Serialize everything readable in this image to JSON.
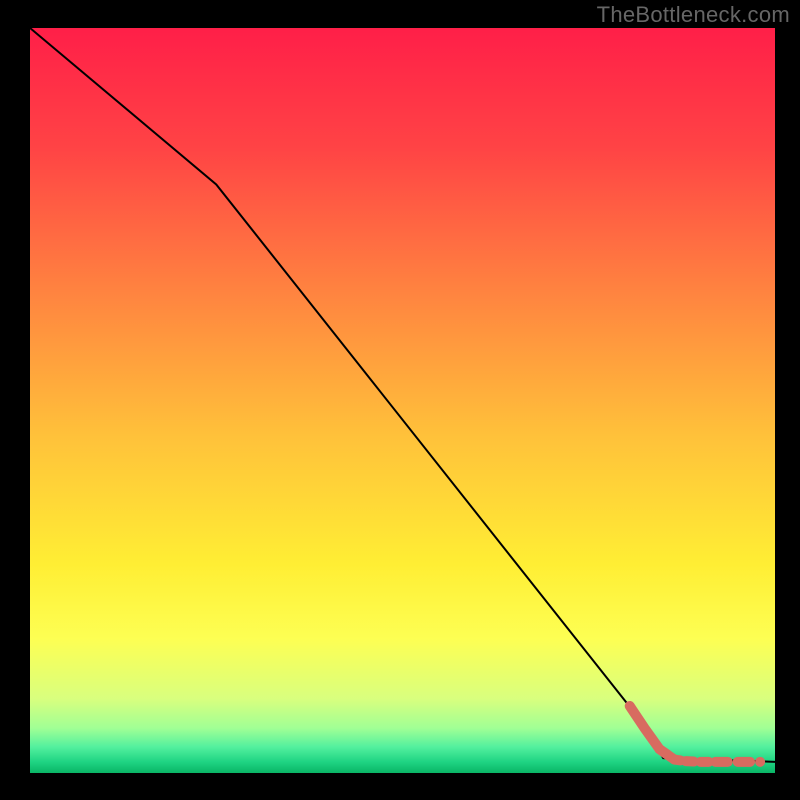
{
  "watermark": "TheBottleneck.com",
  "chart_data": {
    "type": "line",
    "title": "",
    "xlabel": "",
    "ylabel": "",
    "xlim": [
      0,
      100
    ],
    "ylim": [
      0,
      100
    ],
    "grid": false,
    "curve": {
      "name": "bottleneck-curve",
      "color": "#000000",
      "points": [
        {
          "x": 0,
          "y": 100
        },
        {
          "x": 25,
          "y": 79
        },
        {
          "x": 82,
          "y": 7
        },
        {
          "x": 85,
          "y": 2
        },
        {
          "x": 100,
          "y": 1.5
        }
      ]
    },
    "highlight": {
      "name": "bottleneck-highlight",
      "color": "#d86b60",
      "stroke_width": 10,
      "points": [
        {
          "x": 80.5,
          "y": 9
        },
        {
          "x": 82.5,
          "y": 6
        },
        {
          "x": 84.5,
          "y": 3.2
        },
        {
          "x": 86.5,
          "y": 1.8
        },
        {
          "x": 88,
          "y": 1.6
        },
        {
          "x": 90,
          "y": 1.5
        },
        {
          "x": 92,
          "y": 1.5
        },
        {
          "x": 95,
          "y": 1.5
        },
        {
          "x": 98,
          "y": 1.5
        }
      ]
    },
    "background_gradient": {
      "stops": [
        {
          "offset": 0.0,
          "color": "#ff1f48"
        },
        {
          "offset": 0.16,
          "color": "#ff4345"
        },
        {
          "offset": 0.35,
          "color": "#ff8240"
        },
        {
          "offset": 0.55,
          "color": "#ffc23a"
        },
        {
          "offset": 0.72,
          "color": "#ffee34"
        },
        {
          "offset": 0.82,
          "color": "#fdff53"
        },
        {
          "offset": 0.9,
          "color": "#d9ff7e"
        },
        {
          "offset": 0.94,
          "color": "#a0ff95"
        },
        {
          "offset": 0.965,
          "color": "#53f09e"
        },
        {
          "offset": 0.985,
          "color": "#1fd483"
        },
        {
          "offset": 1.0,
          "color": "#0ab566"
        }
      ]
    }
  }
}
